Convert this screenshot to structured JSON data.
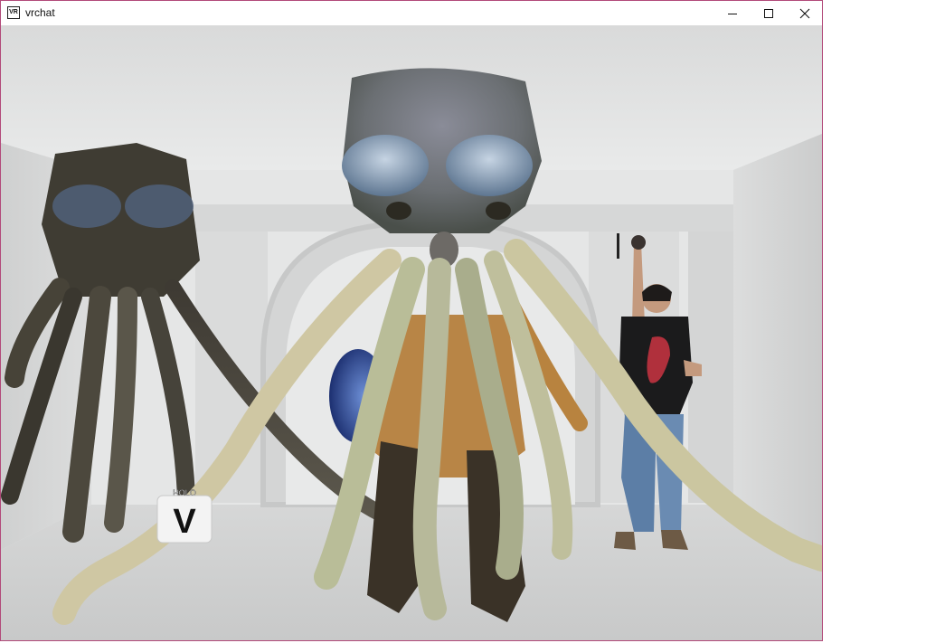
{
  "window": {
    "title": "vrchat",
    "app_icon_text": "VR",
    "frame_color": "#b24a7a"
  },
  "controls": {
    "minimize": "minimize-icon",
    "maximize": "maximize-icon",
    "close": "close-icon"
  },
  "scene": {
    "nameplate_text": "HOLO",
    "badge_letter": "V",
    "wall_color": "#e3e4e4",
    "floor_color": "#d2d3d3"
  }
}
